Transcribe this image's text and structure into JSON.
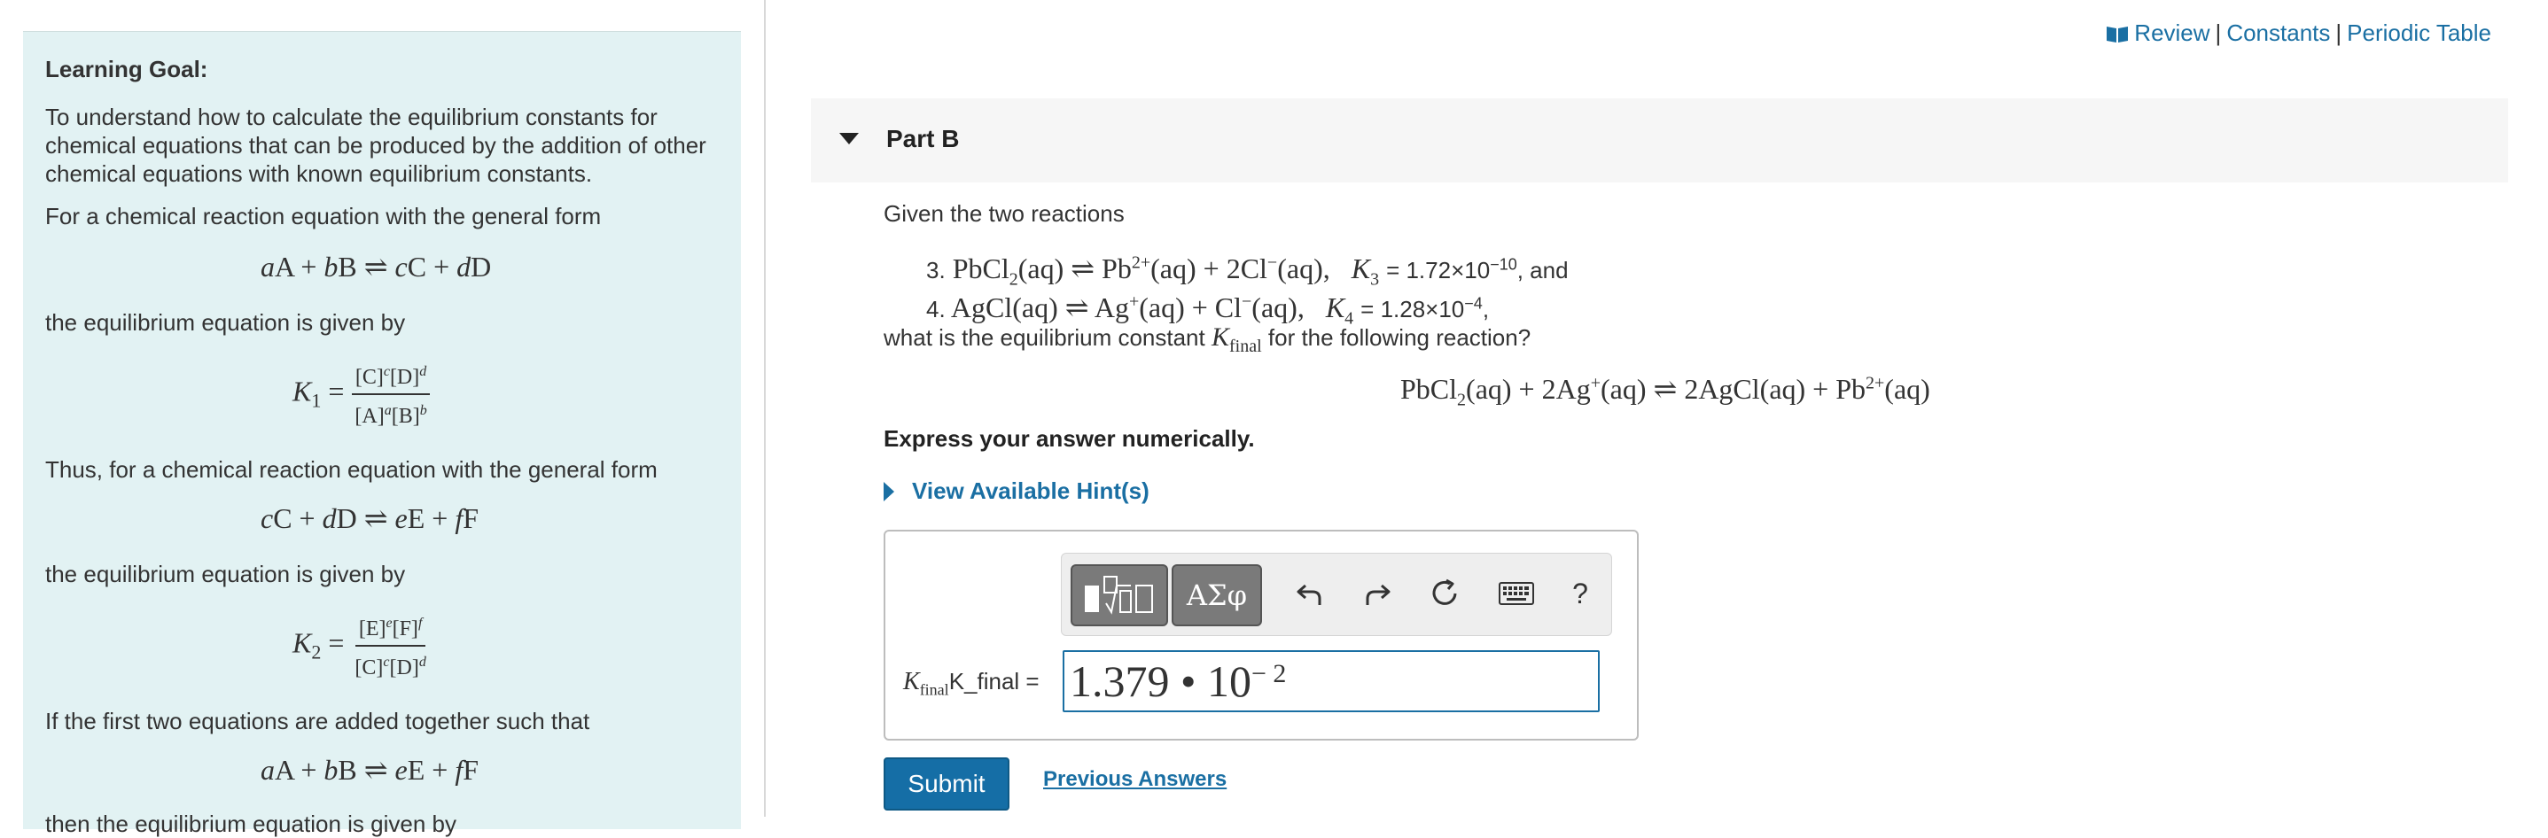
{
  "header": {
    "links": [
      "Review",
      "Constants",
      "Periodic Table"
    ],
    "separator": "|",
    "colors": {
      "link": "#1a6fa3",
      "left_panel_bg": "#e2f2f3",
      "submit_bg": "#156ea6"
    }
  },
  "left_panel": {
    "goal_heading": "Learning Goal:",
    "goal_text": "To understand how to calculate the equilibrium constants for chemical equations that can be produced by the addition of other chemical equations with known equilibrium constants.",
    "general_form_intro": "For a chemical reaction equation with the general form",
    "eq1": "aA + bB ⇌ cC + dD",
    "eq_given_by_1": "the equilibrium equation is given by",
    "k1_label": "K1 =",
    "k1_num": "[C]^c[D]^d",
    "k1_den": "[A]^a[B]^b",
    "thus_text": "Thus, for a chemical reaction equation with the general form",
    "eq2": "cC + dD ⇌ eE + fF",
    "eq_given_by_2": "the equilibrium equation is given by",
    "k2_label": "K2 =",
    "k2_num": "[E]^e[F]^f",
    "k2_den": "[C]^c[D]^d",
    "added_text": "If the first two equations are added together such that",
    "eq3": "aA + bB ⇌ eE + fF",
    "cut_text": "then the equilibrium equation is given by"
  },
  "part": {
    "title": "Part B",
    "given_text": "Given the two reactions",
    "reaction3_prefix": "3.",
    "reaction3_eq": "PbCl2(aq) ⇌ Pb2+(aq) + 2Cl−(aq),",
    "k3": "K3 = 1.72×10−10, and",
    "reaction4_prefix": "4.",
    "reaction4_eq": "AgCl(aq) ⇌ Ag+(aq) + Cl−(aq),",
    "k4": "K4 = 1.28×10−4,",
    "question_text_a": "what is the equilibrium constant",
    "question_kfinal": "Kfinal",
    "question_text_b": "for the following reaction?",
    "target_reaction": "PbCl2(aq) + 2Ag+(aq) ⇌ 2AgCl(aq) + Pb2+(aq)",
    "instruction": "Express your answer numerically.",
    "hint_label": "View Available Hint(s)"
  },
  "answer": {
    "label_math": "Kfinal",
    "label_text": "K_final =",
    "value_mantissa": "1.379 • 10",
    "value_exponent": "− 2",
    "toolbar": [
      "templates",
      "ΑΣφ",
      "undo-icon",
      "redo-icon",
      "reset-icon",
      "keyboard-icon",
      "?"
    ]
  },
  "actions": {
    "submit": "Submit",
    "previous_answers": "Previous Answers"
  }
}
